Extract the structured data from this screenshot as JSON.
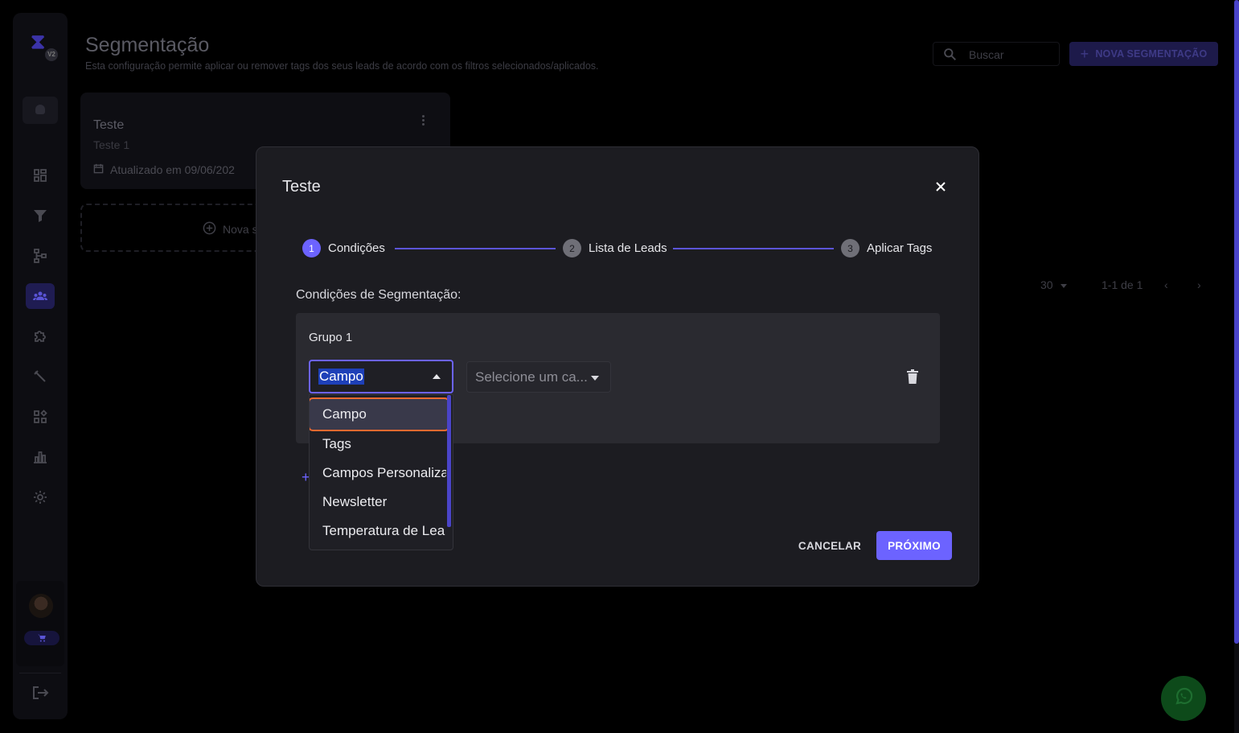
{
  "app": {
    "title": "Segmentação",
    "subtitle": "Esta configuração permite aplicar ou remover tags dos seus leads de acordo com os filtros selecionados/aplicados.",
    "logo_badge": "V2",
    "search": {
      "placeholder": "Buscar"
    },
    "new_button_label": "NOVA SEGMENTAÇÃO",
    "sidebar_icons": [
      "user-icon",
      "dashboard-icon",
      "filter-icon",
      "flow-icon",
      "segmentation-icon",
      "puzzle-icon",
      "wrench-icon",
      "apps-icon",
      "chart-icon",
      "settings-icon",
      "cart-icon",
      "logout-icon"
    ],
    "card": {
      "title": "Teste",
      "subtitle": "Teste 1",
      "updated": "Atualizado em 09/06/202"
    },
    "new_card_label": "Nova s",
    "pagination": {
      "per_page": "30",
      "range": "1-1 de 1"
    },
    "accent_color": "#6c63ff"
  },
  "modal": {
    "title": "Teste",
    "steps": [
      {
        "num": "1",
        "label": "Condições",
        "active": true
      },
      {
        "num": "2",
        "label": "Lista de Leads",
        "active": false
      },
      {
        "num": "3",
        "label": "Aplicar Tags",
        "active": false
      }
    ],
    "section_label": "Condições de Segmentação:",
    "group_title": "Grupo 1",
    "field_select_value": "Campo",
    "condition_select_value": "Selecione um ca...",
    "add_group_text": "+",
    "cancel_label": "CANCELAR",
    "next_label": "PRÓXIMO"
  },
  "dropdown": {
    "options": [
      "Campo",
      "Tags",
      "Campos Personaliza",
      "Newsletter",
      "Temperatura de Lea"
    ],
    "selected": "Campo"
  }
}
